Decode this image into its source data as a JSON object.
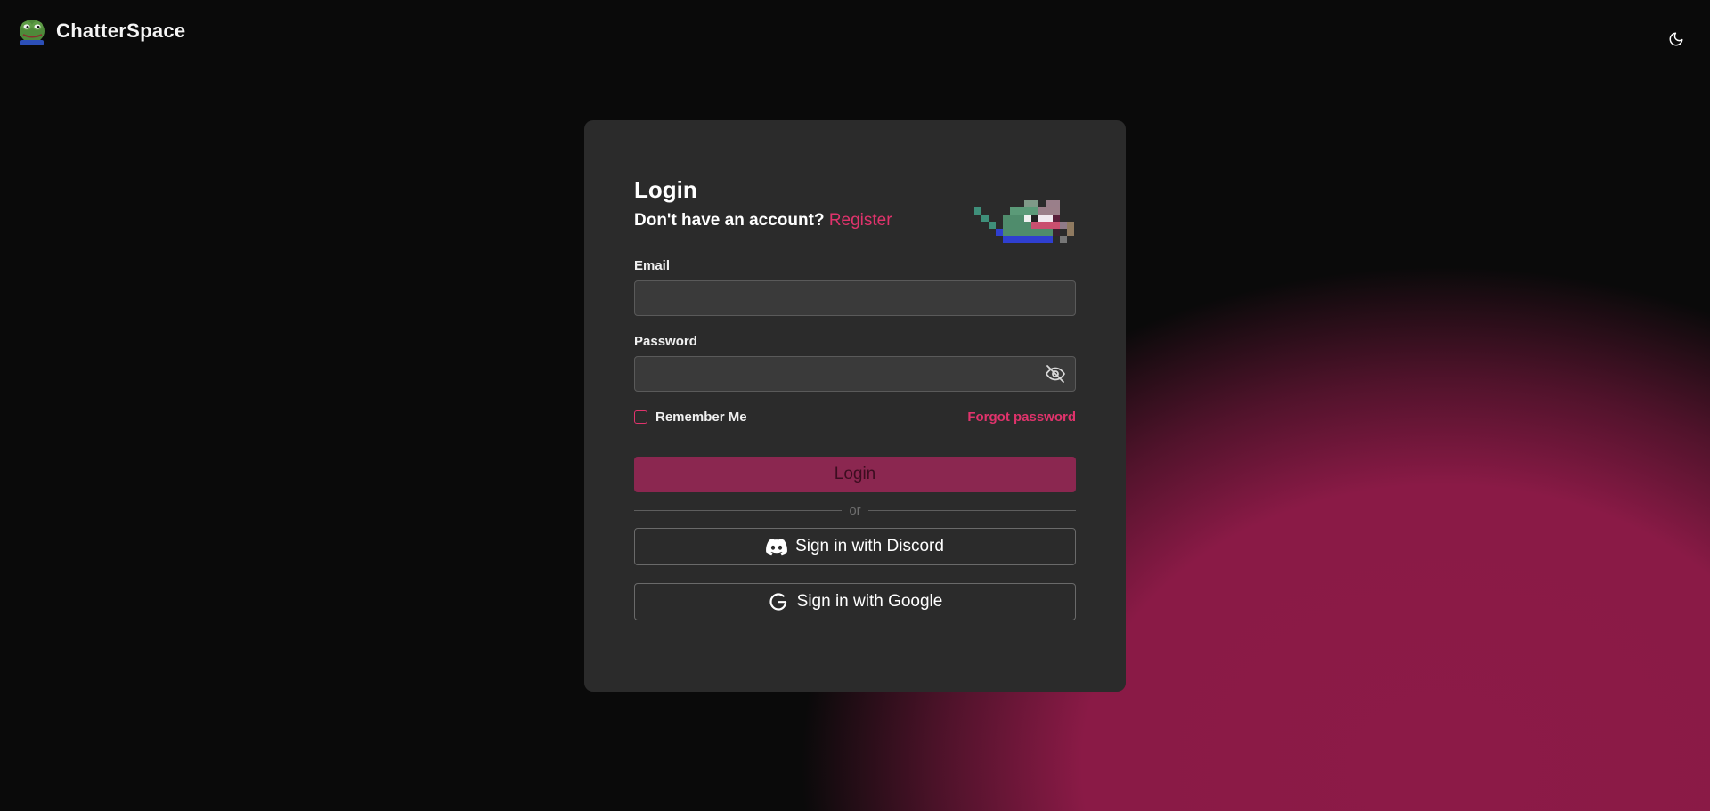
{
  "header": {
    "brand_name": "ChatterSpace",
    "theme_toggle_icon": "moon-icon"
  },
  "login": {
    "title": "Login",
    "no_account_text": "Don't have an account?",
    "register_link": "Register",
    "email_label": "Email",
    "email_value": "",
    "password_label": "Password",
    "password_value": "",
    "remember_label": "Remember Me",
    "remember_checked": false,
    "forgot_link": "Forgot password",
    "login_button": "Login",
    "divider_text": "or",
    "discord_button": "Sign in with Discord",
    "google_button": "Sign in with Google"
  },
  "colors": {
    "accent": "#e0336c",
    "card_bg": "#2b2b2b",
    "page_bg": "#0a0a0a",
    "glow": "#8c1a47",
    "login_button_bg": "#8b2750"
  },
  "icons": {
    "brand_logo": "frog-avatar-icon",
    "mascot": "pixel-frog-icon",
    "password_toggle": "eye-off-icon",
    "discord": "discord-icon",
    "google": "google-icon"
  }
}
